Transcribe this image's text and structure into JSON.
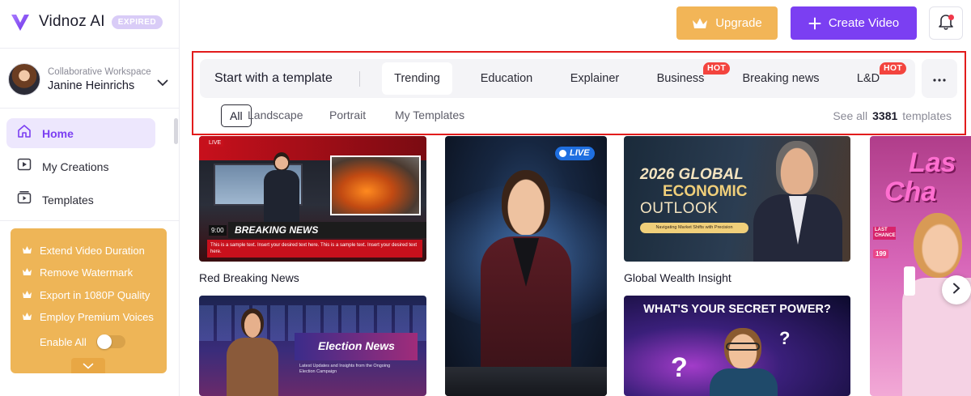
{
  "app": {
    "logo_text": "Vidnoz AI",
    "plan_badge": "EXPIRED",
    "brand_color": "#7b3ff2"
  },
  "workspace": {
    "label": "Collaborative Workspace",
    "user_name": "Janine Heinrichs"
  },
  "nav": {
    "items": [
      {
        "label": "Home",
        "icon": "home-icon",
        "active": true
      },
      {
        "label": "My Creations",
        "icon": "play-square-icon",
        "active": false
      },
      {
        "label": "Templates",
        "icon": "templates-icon",
        "active": false
      }
    ]
  },
  "upsell": {
    "background": "#eeb557",
    "items": [
      "Extend Video Duration",
      "Remove Watermark",
      "Export in 1080P Quality",
      "Employ Premium Voices"
    ],
    "enable_all_label": "Enable All",
    "enable_all_on": false
  },
  "topbar": {
    "upgrade_label": "Upgrade",
    "create_label": "Create Video",
    "has_notification": true
  },
  "template_panel": {
    "title": "Start with a template",
    "tabs": [
      {
        "label": "Trending",
        "active": true,
        "hot": false
      },
      {
        "label": "Education",
        "active": false,
        "hot": false
      },
      {
        "label": "Explainer",
        "active": false,
        "hot": false
      },
      {
        "label": "Business",
        "active": false,
        "hot": true
      },
      {
        "label": "Breaking news",
        "active": false,
        "hot": false
      },
      {
        "label": "L&D",
        "active": false,
        "hot": true
      }
    ],
    "hot_label": "HOT",
    "filters": [
      {
        "label": "All",
        "active": true
      },
      {
        "label": "Landscape",
        "active": false
      },
      {
        "label": "Portrait",
        "active": false
      },
      {
        "label": "My Templates",
        "active": false
      }
    ],
    "see_all_prefix": "See all",
    "template_count": "3381",
    "see_all_suffix": "templates"
  },
  "cards": [
    {
      "title": "Red Breaking News",
      "overlay_live": "LIVE",
      "overlay_headline": "BREAKING NEWS",
      "overlay_time": "9:00",
      "overlay_ticker": "This is a sample text. Insert your desired text here. This is a sample text. Insert your desired text here."
    },
    {
      "title": "",
      "overlay_live": "LIVE"
    },
    {
      "title": "Global Wealth Insight",
      "overlay_line1": "2026 GLOBAL",
      "overlay_line2": "ECONOMIC",
      "overlay_line3": "OUTLOOK",
      "overlay_sub": "Navigating Market Shifts with Precision"
    },
    {
      "title": "",
      "overlay_line1": "Las",
      "overlay_line2": "Cha",
      "overlay_tag": "LAST CHANCE",
      "overlay_price": "199"
    },
    {
      "title": "",
      "overlay_headline": "Election News",
      "overlay_sub": "Latest Updates and Insights from the Ongoing Election Campaign"
    },
    {
      "title": "",
      "overlay_headline": "WHAT'S YOUR SECRET POWER?"
    }
  ]
}
